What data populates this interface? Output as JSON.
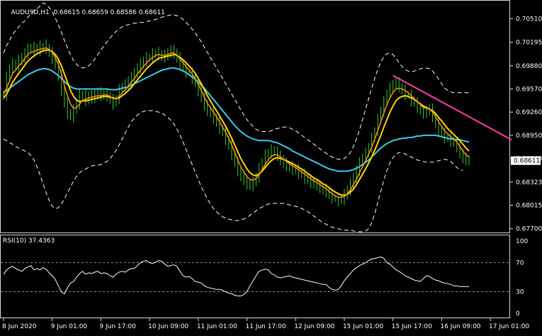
{
  "header": {
    "symbol": "AUDUSD,H1",
    "ohlc": "0.68615 0.68659 0.68586 0.68611"
  },
  "colors": {
    "background": "#000000",
    "frame": "#d8d8d8",
    "candle": "#32cd32",
    "ma_fast": "#ff8c1a",
    "ma_mid": "#ffd700",
    "ma_slow": "#3ec8e6",
    "bands": "#ffffff",
    "trendline": "#ff3ca8",
    "rsi_line": "#ffffff",
    "price_marker_bg": "#ffffff",
    "price_marker_text": "#000000"
  },
  "chart_data": [
    {
      "type": "candlestick",
      "title": "AUDUSD,H1",
      "current_price": "0.68611",
      "ylim": [
        0.6765,
        0.7075
      ],
      "y_ticks": [
        "0.70510",
        "0.70195",
        "0.69880",
        "0.69570",
        "0.69260",
        "0.68950",
        "0.68640",
        "0.68323",
        "0.68015",
        "0.67700"
      ],
      "x_tick_labels": [
        "8 Jun 2020",
        "9 Jun 01:00",
        "9 Jun 17:00",
        "10 Jun 09:00",
        "11 Jun 01:00",
        "11 Jun 17:00",
        "12 Jun 09:00",
        "15 Jun 01:00",
        "15 Jun 17:00",
        "16 Jun 09:00",
        "17 Jun 01:00"
      ],
      "x_tick_index": [
        0,
        16,
        32,
        48,
        64,
        80,
        96,
        112,
        128,
        144,
        160
      ],
      "close": [
        0.695,
        0.6972,
        0.6985,
        0.699,
        0.6988,
        0.6995,
        0.6998,
        0.7005,
        0.701,
        0.7012,
        0.7008,
        0.7013,
        0.701,
        0.7015,
        0.7012,
        0.7005,
        0.6998,
        0.699,
        0.6975,
        0.6955,
        0.6938,
        0.6925,
        0.692,
        0.6928,
        0.6938,
        0.6948,
        0.695,
        0.6942,
        0.6948,
        0.6945,
        0.695,
        0.6952,
        0.6948,
        0.695,
        0.6948,
        0.6942,
        0.6938,
        0.6945,
        0.6955,
        0.696,
        0.6962,
        0.6968,
        0.6972,
        0.6978,
        0.6985,
        0.699,
        0.6995,
        0.6998,
        0.7,
        0.7003,
        0.7005,
        0.7003,
        0.7,
        0.7002,
        0.7005,
        0.7008,
        0.7005,
        0.6998,
        0.699,
        0.6985,
        0.698,
        0.6978,
        0.6972,
        0.6965,
        0.6955,
        0.6945,
        0.6935,
        0.6928,
        0.6925,
        0.6918,
        0.6912,
        0.6905,
        0.6898,
        0.689,
        0.688,
        0.687,
        0.6858,
        0.6848,
        0.684,
        0.6835,
        0.683,
        0.6828,
        0.6832,
        0.684,
        0.685,
        0.686,
        0.6868,
        0.6872,
        0.6875,
        0.6873,
        0.6868,
        0.6862,
        0.6858,
        0.6855,
        0.6852,
        0.685,
        0.6848,
        0.6845,
        0.6842,
        0.6838,
        0.6835,
        0.6832,
        0.683,
        0.6828,
        0.6825,
        0.6822,
        0.682,
        0.6815,
        0.6812,
        0.681,
        0.6808,
        0.681,
        0.6815,
        0.6822,
        0.683,
        0.6838,
        0.6848,
        0.6858,
        0.6865,
        0.687,
        0.688,
        0.689,
        0.6902,
        0.6915,
        0.6928,
        0.694,
        0.695,
        0.6958,
        0.6962,
        0.6965,
        0.696,
        0.6955,
        0.695,
        0.6948,
        0.6942,
        0.6938,
        0.6933,
        0.6928,
        0.6925,
        0.6928,
        0.693,
        0.692,
        0.691,
        0.6902,
        0.6897,
        0.6893,
        0.689,
        0.6888,
        0.6885,
        0.688,
        0.687,
        0.6865,
        0.6862,
        0.6861
      ],
      "ma_fast": [
        0.695,
        0.6958,
        0.6968,
        0.6978,
        0.6982,
        0.6988,
        0.6992,
        0.6998,
        0.7003,
        0.7006,
        0.7007,
        0.7009,
        0.701,
        0.7011,
        0.7012,
        0.701,
        0.7006,
        0.6999,
        0.699,
        0.6978,
        0.6962,
        0.6948,
        0.6937,
        0.6931,
        0.6932,
        0.6937,
        0.6942,
        0.6943,
        0.6945,
        0.6946,
        0.6947,
        0.6948,
        0.6948,
        0.6949,
        0.6949,
        0.6947,
        0.6944,
        0.6944,
        0.6947,
        0.6952,
        0.6956,
        0.6961,
        0.6966,
        0.6971,
        0.6977,
        0.6982,
        0.6987,
        0.6992,
        0.6996,
        0.6999,
        0.7002,
        0.7003,
        0.7002,
        0.7002,
        0.7003,
        0.7005,
        0.7005,
        0.7002,
        0.6997,
        0.6992,
        0.6987,
        0.6982,
        0.6977,
        0.6971,
        0.6963,
        0.6955,
        0.6946,
        0.6938,
        0.6932,
        0.6926,
        0.692,
        0.6913,
        0.6906,
        0.6899,
        0.6891,
        0.6882,
        0.6872,
        0.6862,
        0.6853,
        0.6846,
        0.684,
        0.6836,
        0.6835,
        0.6837,
        0.6842,
        0.6849,
        0.6856,
        0.6862,
        0.6867,
        0.6869,
        0.6869,
        0.6866,
        0.6863,
        0.686,
        0.6857,
        0.6854,
        0.6852,
        0.6849,
        0.6846,
        0.6843,
        0.684,
        0.6837,
        0.6834,
        0.6832,
        0.6829,
        0.6826,
        0.6824,
        0.682,
        0.6817,
        0.6814,
        0.6812,
        0.6812,
        0.6813,
        0.6817,
        0.6822,
        0.6829,
        0.6836,
        0.6845,
        0.6853,
        0.6861,
        0.687,
        0.6879,
        0.689,
        0.6901,
        0.6913,
        0.6925,
        0.6936,
        0.6945,
        0.6952,
        0.6957,
        0.6958,
        0.6957,
        0.6955,
        0.6952,
        0.6948,
        0.6944,
        0.694,
        0.6936,
        0.6932,
        0.6931,
        0.693,
        0.6926,
        0.692,
        0.6913,
        0.6907,
        0.6901,
        0.6897,
        0.6893,
        0.689,
        0.6886,
        0.688,
        0.6874,
        0.6869,
        0.6866
      ],
      "ma_mid": [
        0.6945,
        0.695,
        0.6958,
        0.6966,
        0.6972,
        0.6978,
        0.6983,
        0.6989,
        0.6994,
        0.6998,
        0.7001,
        0.7004,
        0.7006,
        0.7008,
        0.7009,
        0.7009,
        0.7007,
        0.7003,
        0.6997,
        0.6988,
        0.6977,
        0.6966,
        0.6955,
        0.6947,
        0.6942,
        0.694,
        0.6941,
        0.6941,
        0.6942,
        0.6943,
        0.6944,
        0.6945,
        0.6946,
        0.6947,
        0.6947,
        0.6946,
        0.6945,
        0.6944,
        0.6945,
        0.6948,
        0.6951,
        0.6955,
        0.6959,
        0.6964,
        0.6969,
        0.6974,
        0.6979,
        0.6984,
        0.6988,
        0.6992,
        0.6995,
        0.6998,
        0.6999,
        0.7,
        0.7001,
        0.7002,
        0.7003,
        0.7002,
        0.6999,
        0.6996,
        0.6992,
        0.6988,
        0.6983,
        0.6978,
        0.6971,
        0.6964,
        0.6956,
        0.6948,
        0.6941,
        0.6934,
        0.6928,
        0.6921,
        0.6914,
        0.6907,
        0.6899,
        0.6891,
        0.6882,
        0.6873,
        0.6864,
        0.6857,
        0.685,
        0.6845,
        0.6842,
        0.6841,
        0.6843,
        0.6847,
        0.6852,
        0.6857,
        0.6861,
        0.6864,
        0.6865,
        0.6864,
        0.6863,
        0.6861,
        0.6859,
        0.6857,
        0.6855,
        0.6852,
        0.685,
        0.6847,
        0.6844,
        0.6841,
        0.6838,
        0.6836,
        0.6833,
        0.683,
        0.6828,
        0.6825,
        0.6822,
        0.6819,
        0.6817,
        0.6815,
        0.6815,
        0.6816,
        0.6819,
        0.6823,
        0.6829,
        0.6836,
        0.6843,
        0.685,
        0.6858,
        0.6866,
        0.6875,
        0.6885,
        0.6895,
        0.6906,
        0.6916,
        0.6926,
        0.6934,
        0.6941,
        0.6945,
        0.6947,
        0.6948,
        0.6947,
        0.6945,
        0.6943,
        0.694,
        0.6937,
        0.6934,
        0.6932,
        0.693,
        0.6928,
        0.6924,
        0.6919,
        0.6914,
        0.6909,
        0.6904,
        0.69,
        0.6896,
        0.6892,
        0.6888,
        0.6883,
        0.6878,
        0.6874
      ],
      "ma_slow": [
        0.6953,
        0.6955,
        0.6958,
        0.6961,
        0.6964,
        0.6967,
        0.697,
        0.6973,
        0.6976,
        0.6978,
        0.698,
        0.6982,
        0.6983,
        0.6984,
        0.6984,
        0.6983,
        0.6981,
        0.6978,
        0.6975,
        0.6971,
        0.6967,
        0.6963,
        0.696,
        0.6958,
        0.6957,
        0.6957,
        0.6957,
        0.6957,
        0.6957,
        0.6957,
        0.6957,
        0.6957,
        0.6957,
        0.6957,
        0.6957,
        0.6956,
        0.6956,
        0.6956,
        0.6957,
        0.6958,
        0.6959,
        0.696,
        0.6962,
        0.6964,
        0.6966,
        0.6968,
        0.697,
        0.6972,
        0.6974,
        0.6976,
        0.6978,
        0.698,
        0.6982,
        0.6983,
        0.6984,
        0.6985,
        0.6985,
        0.6984,
        0.6983,
        0.6981,
        0.6979,
        0.6976,
        0.6973,
        0.697,
        0.6966,
        0.6962,
        0.6958,
        0.6953,
        0.6948,
        0.6943,
        0.6938,
        0.6933,
        0.6928,
        0.6923,
        0.6918,
        0.6913,
        0.6908,
        0.6904,
        0.69,
        0.6897,
        0.6894,
        0.6892,
        0.689,
        0.6889,
        0.6888,
        0.6888,
        0.6888,
        0.6888,
        0.6887,
        0.6886,
        0.6885,
        0.6883,
        0.6881,
        0.6879,
        0.6877,
        0.6874,
        0.6872,
        0.687,
        0.6868,
        0.6866,
        0.6864,
        0.6862,
        0.686,
        0.6858,
        0.6856,
        0.6854,
        0.6852,
        0.685,
        0.6849,
        0.6848,
        0.6847,
        0.6847,
        0.6847,
        0.6847,
        0.6848,
        0.6849,
        0.6851,
        0.6853,
        0.6856,
        0.6859,
        0.6862,
        0.6866,
        0.687,
        0.6874,
        0.6878,
        0.6881,
        0.6884,
        0.6886,
        0.6888,
        0.6889,
        0.689,
        0.6891,
        0.6891,
        0.6892,
        0.6892,
        0.6893,
        0.6894,
        0.6894,
        0.6895,
        0.6895,
        0.6895,
        0.6895,
        0.6895,
        0.6894,
        0.6893,
        0.6892,
        0.6891,
        0.689,
        0.689,
        0.6889,
        0.6889,
        0.6888,
        0.6887,
        0.6886
      ],
      "band_upper": [
        0.7005,
        0.7015,
        0.7022,
        0.703,
        0.7035,
        0.704,
        0.7045,
        0.7048,
        0.7053,
        0.7058,
        0.7062,
        0.7064,
        0.7068,
        0.7072,
        0.707,
        0.7066,
        0.706,
        0.7052,
        0.7043,
        0.7033,
        0.7022,
        0.7012,
        0.7003,
        0.6995,
        0.699,
        0.6986,
        0.6985,
        0.6986,
        0.6988,
        0.6992,
        0.6997,
        0.7003,
        0.7009,
        0.7015,
        0.702,
        0.7025,
        0.703,
        0.7034,
        0.7038,
        0.704,
        0.7042,
        0.7043,
        0.7044,
        0.7045,
        0.7045,
        0.7046,
        0.7046,
        0.7047,
        0.7048,
        0.7049,
        0.705,
        0.7052,
        0.7053,
        0.7054,
        0.7055,
        0.7056,
        0.7056,
        0.7055,
        0.7053,
        0.705,
        0.7046,
        0.7042,
        0.7037,
        0.7032,
        0.7026,
        0.702,
        0.7013,
        0.7006,
        0.6999,
        0.6992,
        0.6985,
        0.6978,
        0.6971,
        0.6964,
        0.6957,
        0.695,
        0.6943,
        0.6936,
        0.6929,
        0.6922,
        0.6916,
        0.6911,
        0.6907,
        0.6903,
        0.6901,
        0.69,
        0.69,
        0.69,
        0.6901,
        0.6903,
        0.6904,
        0.6905,
        0.6906,
        0.6906,
        0.6905,
        0.6903,
        0.6901,
        0.6898,
        0.6895,
        0.6892,
        0.6889,
        0.6886,
        0.6883,
        0.688,
        0.6877,
        0.6874,
        0.6871,
        0.6868,
        0.6866,
        0.6864,
        0.6863,
        0.6863,
        0.6864,
        0.6867,
        0.6872,
        0.688,
        0.689,
        0.6902,
        0.6916,
        0.693,
        0.6944,
        0.6958,
        0.6971,
        0.6983,
        0.6993,
        0.7,
        0.7004,
        0.7005,
        0.7003,
        0.6998,
        0.6992,
        0.6987,
        0.6983,
        0.6981,
        0.698,
        0.6981,
        0.6982,
        0.6984,
        0.6985,
        0.6985,
        0.6984,
        0.6981,
        0.6976,
        0.697,
        0.6964,
        0.6958,
        0.6955,
        0.6953,
        0.6952,
        0.6952,
        0.6952,
        0.6952,
        0.6952,
        0.6952
      ],
      "band_lower": [
        0.689,
        0.6888,
        0.6885,
        0.6883,
        0.688,
        0.6878,
        0.6876,
        0.6874,
        0.6872,
        0.6868,
        0.6862,
        0.6853,
        0.6842,
        0.683,
        0.6818,
        0.6808,
        0.68,
        0.6797,
        0.6798,
        0.6803,
        0.681,
        0.6818,
        0.6826,
        0.6834,
        0.684,
        0.6845,
        0.6848,
        0.685,
        0.6852,
        0.6854,
        0.6855,
        0.6855,
        0.6856,
        0.6858,
        0.686,
        0.6864,
        0.6869,
        0.6875,
        0.6882,
        0.689,
        0.6898,
        0.6906,
        0.6913,
        0.6918,
        0.6922,
        0.6925,
        0.6927,
        0.6928,
        0.6928,
        0.6928,
        0.6927,
        0.6926,
        0.6925,
        0.6922,
        0.6919,
        0.6915,
        0.691,
        0.6903,
        0.6895,
        0.6886,
        0.6876,
        0.6866,
        0.6856,
        0.6846,
        0.6836,
        0.6826,
        0.6818,
        0.681,
        0.6803,
        0.6797,
        0.6793,
        0.6789,
        0.6786,
        0.6784,
        0.6783,
        0.6782,
        0.6781,
        0.6781,
        0.6782,
        0.6783,
        0.6785,
        0.6788,
        0.6791,
        0.6794,
        0.6797,
        0.6799,
        0.6801,
        0.6803,
        0.6804,
        0.6804,
        0.6804,
        0.6804,
        0.6804,
        0.6803,
        0.6802,
        0.6801,
        0.68,
        0.6799,
        0.6797,
        0.6795,
        0.6793,
        0.679,
        0.6787,
        0.6784,
        0.6781,
        0.6778,
        0.6776,
        0.6774,
        0.6772,
        0.6771,
        0.677,
        0.6769,
        0.6768,
        0.6768,
        0.6768,
        0.6767,
        0.6766,
        0.6766,
        0.6766,
        0.6767,
        0.677,
        0.6778,
        0.679,
        0.6805,
        0.682,
        0.6835,
        0.6848,
        0.6858,
        0.6865,
        0.687,
        0.6872,
        0.6872,
        0.687,
        0.6868,
        0.6866,
        0.6864,
        0.6862,
        0.6861,
        0.686,
        0.6859,
        0.6859,
        0.6859,
        0.686,
        0.6861,
        0.6862,
        0.6863,
        0.6862,
        0.686,
        0.6856,
        0.6852,
        0.6849,
        0.6848
      ],
      "trendline": {
        "from": {
          "index": 128,
          "value": 0.6975
        },
        "to": {
          "index": 167,
          "value": 0.6889
        }
      }
    },
    {
      "type": "line",
      "title": "RSI(10) 37.4363",
      "ylim": [
        0,
        100
      ],
      "y_ticks": [
        "100",
        "70",
        "30",
        "0"
      ],
      "levels": [
        70,
        30
      ],
      "values": [
        54,
        60,
        63,
        65,
        62,
        60,
        58,
        62,
        64,
        66,
        60,
        62,
        60,
        63,
        61,
        56,
        52,
        47,
        38,
        30,
        27,
        35,
        42,
        44,
        50,
        55,
        58,
        54,
        56,
        55,
        57,
        58,
        55,
        56,
        55,
        52,
        50,
        54,
        57,
        58,
        57,
        60,
        62,
        62,
        66,
        70,
        72,
        73,
        70,
        69,
        71,
        73,
        72,
        68,
        65,
        66,
        67,
        65,
        58,
        52,
        50,
        51,
        48,
        44,
        43,
        42,
        38,
        36,
        35,
        34,
        33,
        33,
        32,
        30,
        28,
        27,
        25,
        24,
        24,
        26,
        30,
        38,
        45,
        52,
        58,
        60,
        61,
        60,
        55,
        53,
        50,
        49,
        50,
        51,
        52,
        50,
        49,
        48,
        47,
        46,
        45,
        44,
        43,
        42,
        41,
        40,
        40,
        36,
        33,
        32,
        33,
        38,
        45,
        50,
        55,
        60,
        63,
        66,
        68,
        70,
        73,
        75,
        76,
        77,
        78,
        76,
        70,
        68,
        64,
        60,
        58,
        55,
        52,
        50,
        48,
        46,
        45,
        44,
        48,
        52,
        51,
        48,
        46,
        45,
        43,
        42,
        41,
        40,
        38,
        38,
        37,
        37,
        37,
        37
      ]
    }
  ]
}
